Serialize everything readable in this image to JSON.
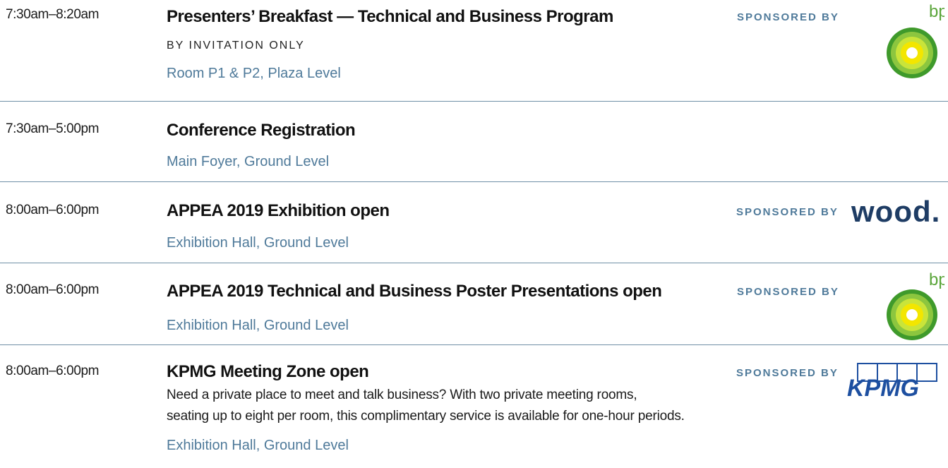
{
  "sessions": [
    {
      "time": "7:30am–8:20am",
      "title": "Presenters’ Breakfast — Technical and Business Program",
      "note": "BY INVITATION ONLY",
      "location": "Room P1 & P2, Plaza Level",
      "sponsored_label": "SPONSORED BY",
      "sponsor_logo": "bp"
    },
    {
      "time": "7:30am–5:00pm",
      "title": "Conference Registration",
      "location": "Main Foyer, Ground Level"
    },
    {
      "time": "8:00am–6:00pm",
      "title": "APPEA 2019 Exhibition open",
      "location": "Exhibition Hall, Ground Level",
      "sponsored_label": "SPONSORED BY",
      "sponsor_logo": "wood."
    },
    {
      "time": "8:00am–6:00pm",
      "title": "APPEA 2019 Technical and Business Poster Presentations open",
      "location": "Exhibition Hall, Ground Level",
      "sponsored_label": "SPONSORED BY",
      "sponsor_logo": "bp"
    },
    {
      "time": "8:00am–6:00pm",
      "title": "KPMG Meeting Zone open",
      "description_line1": "Need a private place to meet and talk business? With two private meeting rooms,",
      "description_line2": "seating up to eight per room, this complimentary service is available for one-hour periods.",
      "location": "Exhibition Hall, Ground Level",
      "sponsored_label": "SPONSORED BY",
      "sponsor_logo": "KPMG"
    }
  ],
  "colors": {
    "location_text": "#4f7a9a",
    "divider": "#6f8fa6",
    "bp_green": "#5aa53a",
    "bp_yellow": "#f3e600",
    "wood_navy": "#1e3c64",
    "kpmg_blue": "#1d4fa0"
  }
}
